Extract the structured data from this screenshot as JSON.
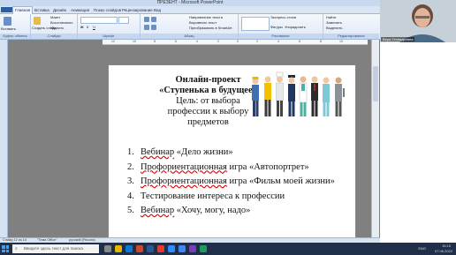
{
  "window": {
    "title": "ПРЕЗЕНТ - Microsoft PowerPoint",
    "controls": [
      "–",
      "□",
      "×"
    ]
  },
  "ribbon": {
    "tabs": [
      "Главная",
      "Вставка",
      "Дизайн",
      "Анимация",
      "Показ слайдов",
      "Рецензирование",
      "Вид"
    ],
    "active_tab": "Главная",
    "groups": {
      "clipboard": {
        "label": "Буфер обмена",
        "paste": "Вставить"
      },
      "slides": {
        "label": "Слайды",
        "create": "Создать слайд",
        "layout": "Макет",
        "restore": "Восстановить",
        "delete": "Удалить"
      },
      "font": {
        "label": "Шрифт"
      },
      "paragraph": {
        "label": "Абзац",
        "direction": "Направление текста",
        "align": "Выровнять текст",
        "smartart": "Преобразовать в SmartArt"
      },
      "drawing": {
        "label": "Рисование",
        "shapes": "Фигуры",
        "arrange": "Упорядочить",
        "quick_styles": "Экспресс-стили"
      },
      "editing": {
        "label": "Редактирование",
        "find": "Найти",
        "replace": "Заменить",
        "select": "Выделить"
      }
    }
  },
  "slide": {
    "title_lines": [
      "Онлайн-проект",
      "«Ступенька в будущее»"
    ],
    "goal_lines": [
      "Цель: от выбора",
      "профессии к выбору",
      "предметов"
    ],
    "items": [
      {
        "num": "1.",
        "a": "Вебинар",
        "b": " «Дело жизни»"
      },
      {
        "num": "2.",
        "a": "Профориентационная",
        "b": " игра «Автопортрет»"
      },
      {
        "num": "3.",
        "a": "Профориентационная",
        "b": " игра «Фильм моей жизни»"
      },
      {
        "num": "4.",
        "a": "",
        "b": "Тестирование интереса к профессии"
      },
      {
        "num": "5.",
        "a": "Вебинар",
        "b": " «Хочу, могу, надо»"
      }
    ]
  },
  "status_bar": {
    "slide": "Слайд 12 из 14",
    "theme": "\"Тема Office\"",
    "language": "русский (Россия)"
  },
  "taskbar": {
    "search_placeholder": "Введите здесь текст для поиска",
    "language": "ENG",
    "time": "15:15",
    "date": "07.06.2022"
  },
  "webcam": {
    "name": "Вера Геннадьевна"
  }
}
